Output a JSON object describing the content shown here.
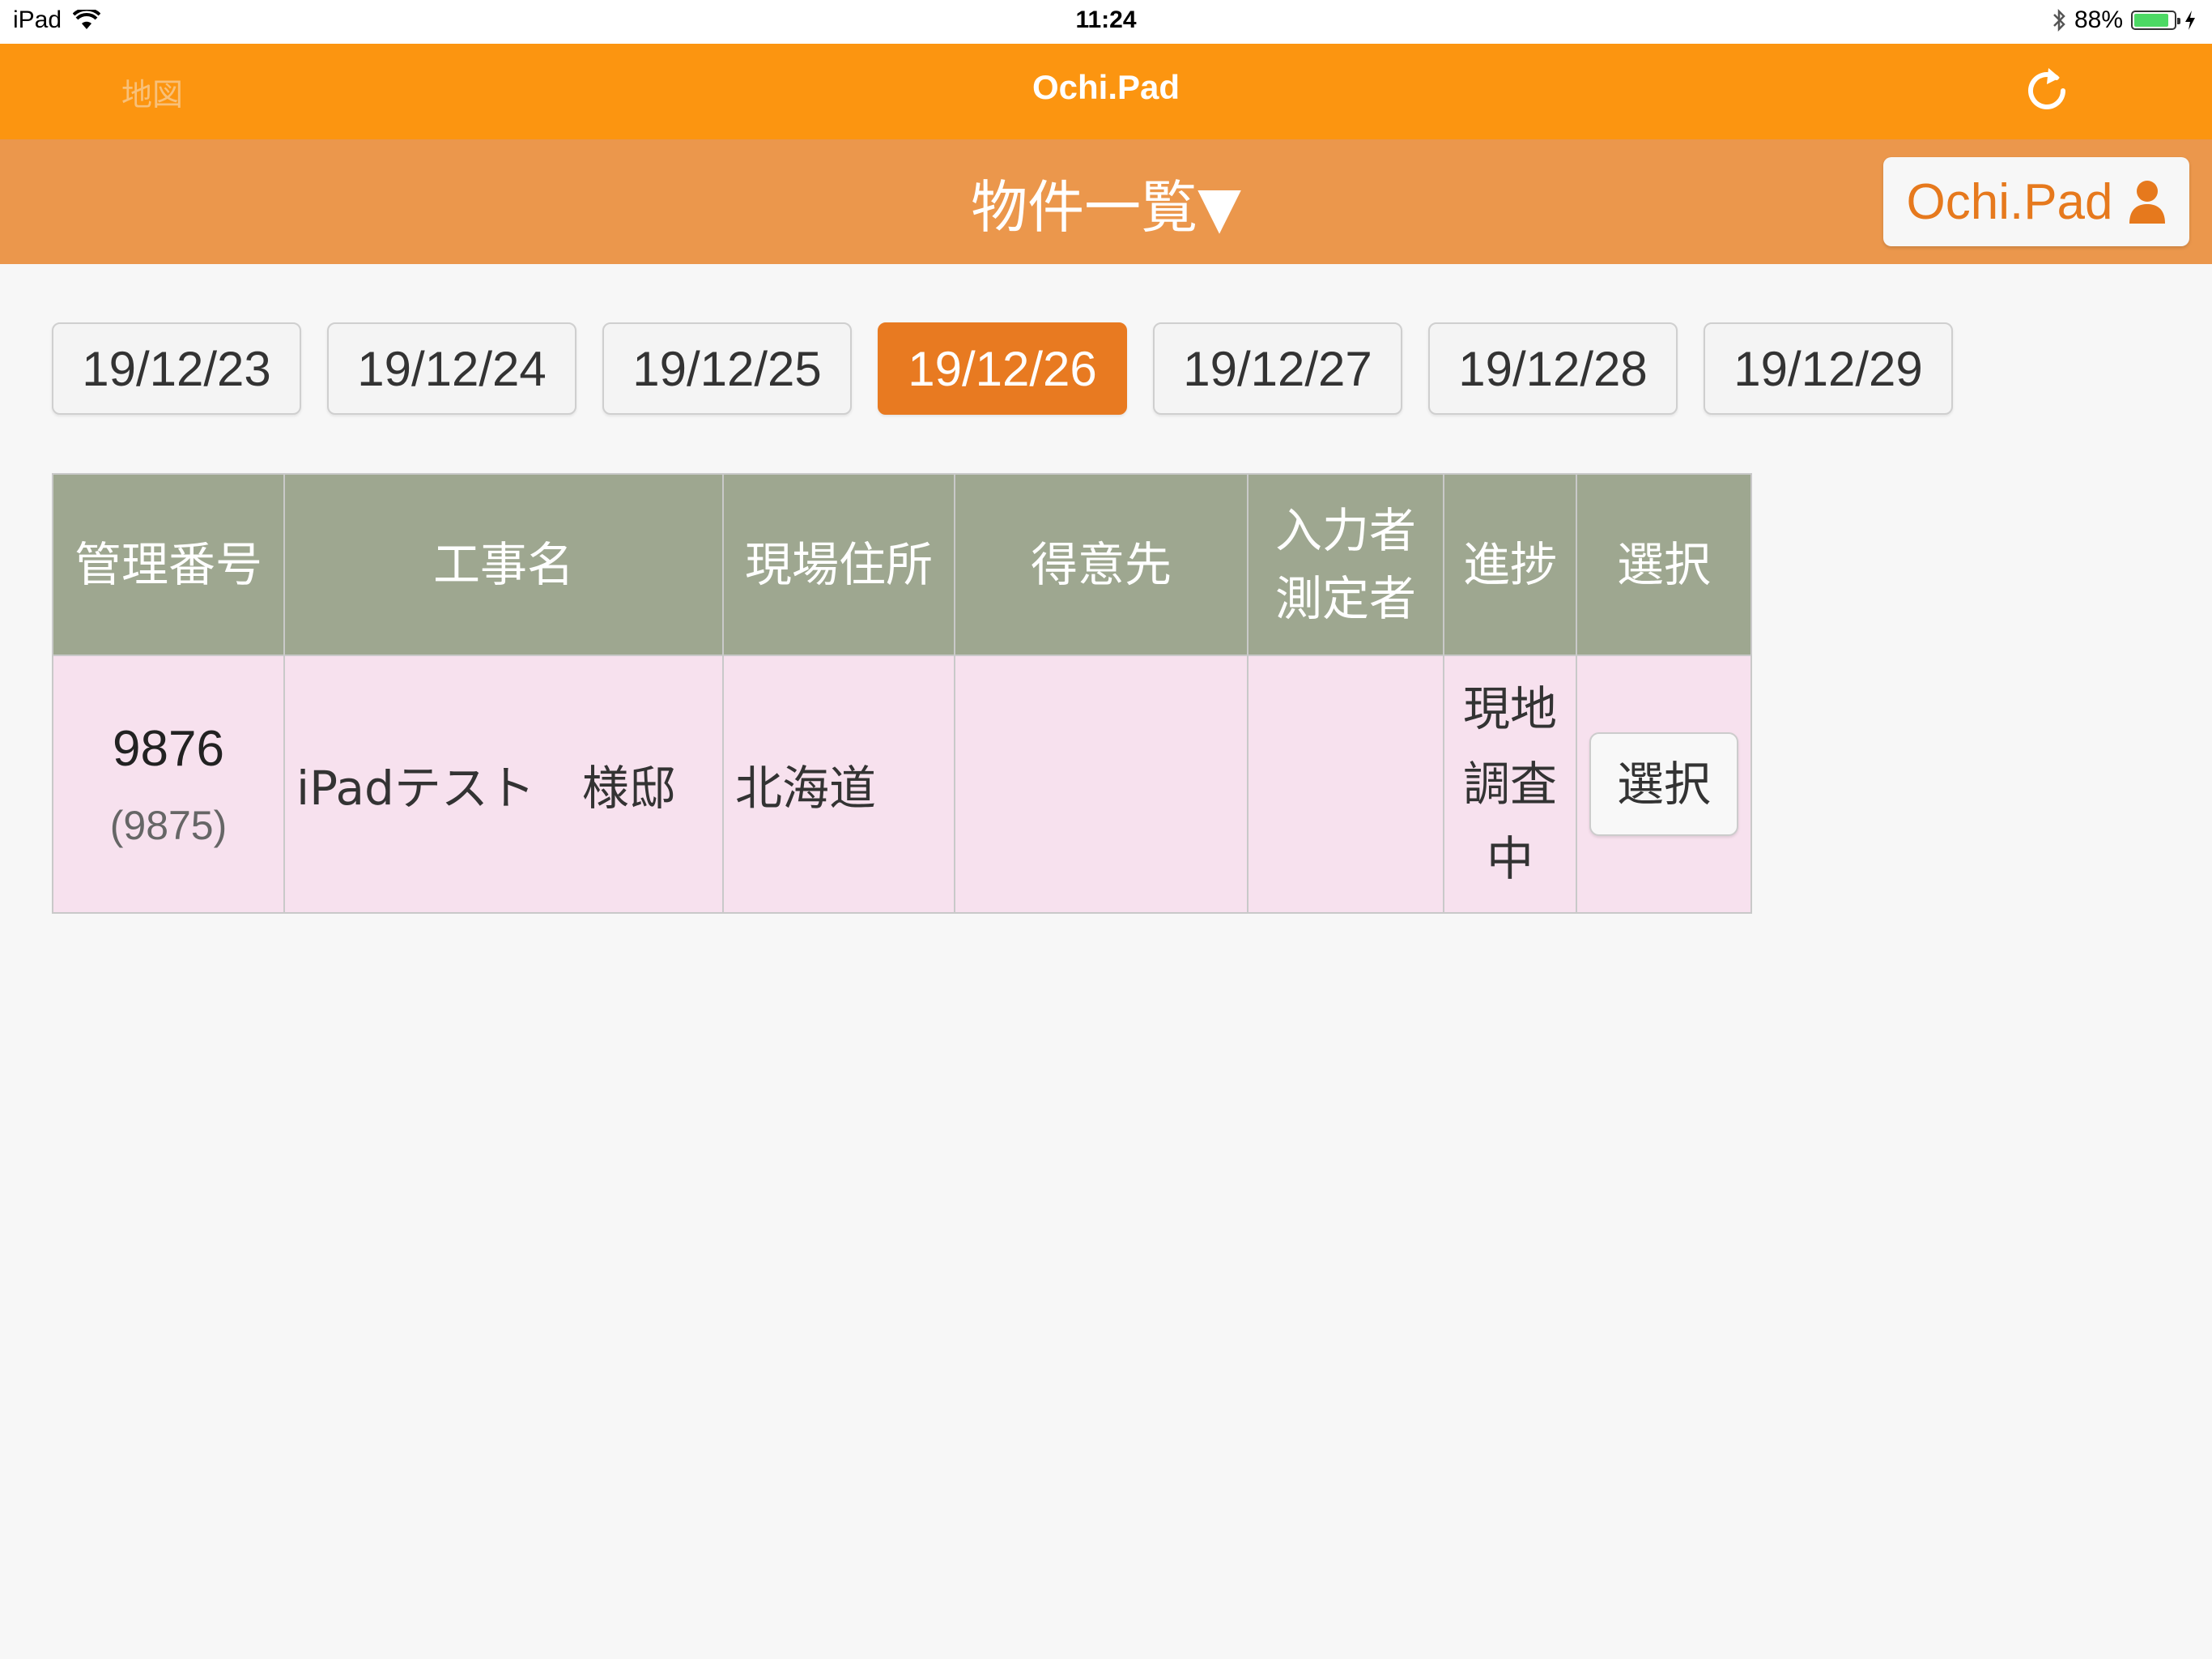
{
  "status_bar": {
    "device": "iPad",
    "time": "11:24",
    "battery_percent": "88%",
    "battery_level": 0.88
  },
  "nav": {
    "left_link": "地図",
    "title": "Ochi.Pad"
  },
  "sub_header": {
    "title": "物件一覧▼",
    "user_button_label": "Ochi.Pad"
  },
  "date_tabs": [
    "19/12/23",
    "19/12/24",
    "19/12/25",
    "19/12/26",
    "19/12/27",
    "19/12/28",
    "19/12/29"
  ],
  "active_date": "19/12/26",
  "table": {
    "headers": {
      "id": "管理番号",
      "name": "工事名",
      "address": "現場住所",
      "client": "得意先",
      "input_by_line1": "入力者",
      "input_by_line2": "測定者",
      "progress": "進捗",
      "select": "選択"
    },
    "rows": [
      {
        "id": "9876",
        "sub_id": "(9875)",
        "name": "iPadテスト　様邸",
        "address": "北海道",
        "client": "",
        "input_by": "",
        "progress_line1": "現地",
        "progress_line2": "調査",
        "progress_line3": "中",
        "select_label": "選択"
      }
    ]
  },
  "colors": {
    "nav_orange": "#fc9510",
    "sub_header_orange": "#eb974c",
    "active_tab": "#e87a21",
    "table_header": "#9ea790",
    "row_pink": "#f7e1ee"
  }
}
